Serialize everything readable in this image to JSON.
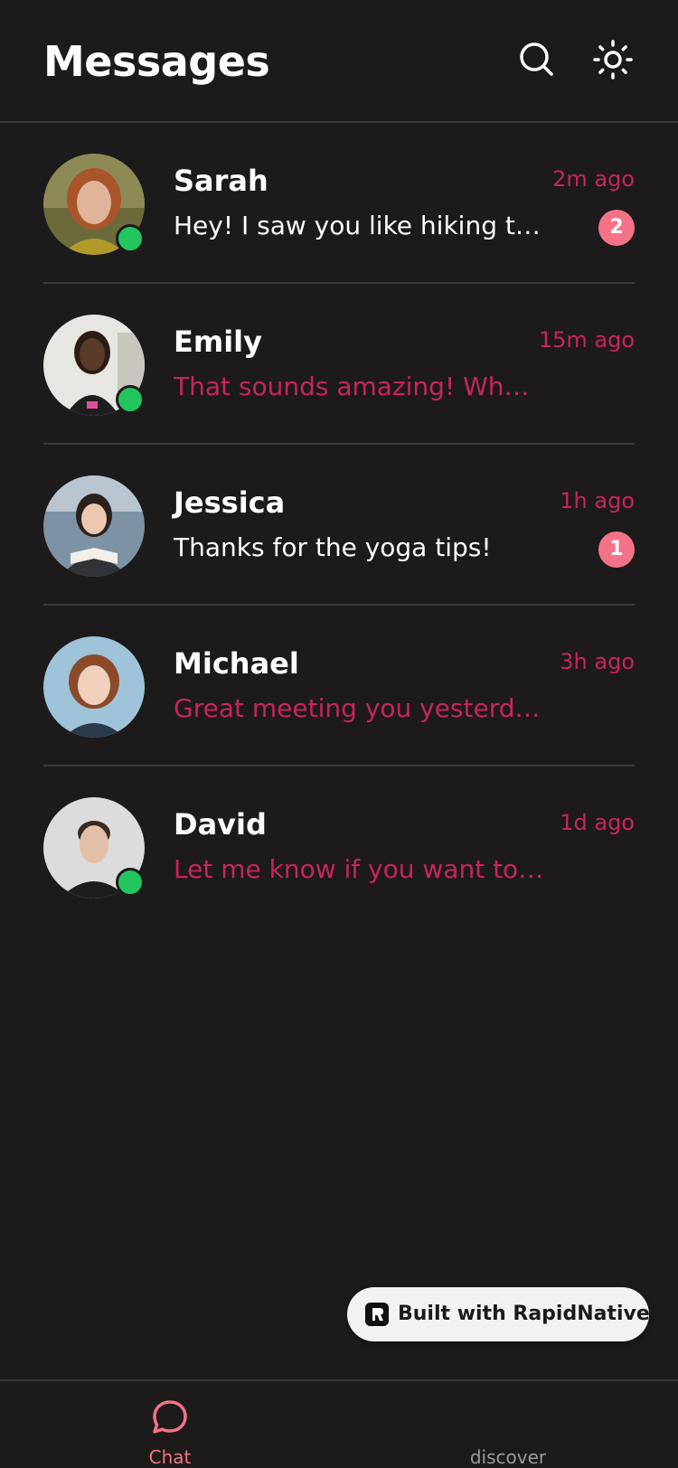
{
  "header": {
    "title": "Messages",
    "search_icon": "search-icon",
    "theme_icon": "sun-icon"
  },
  "chats": [
    {
      "name": "Sarah",
      "time": "2m ago",
      "preview": "Hey! I saw you like hiking too!",
      "unread": "2",
      "online": true,
      "preview_highlight": false
    },
    {
      "name": "Emily",
      "time": "15m ago",
      "preview": "That sounds amazing! When ...",
      "unread": null,
      "online": true,
      "preview_highlight": true
    },
    {
      "name": "Jessica",
      "time": "1h ago",
      "preview": "Thanks for the yoga tips!",
      "unread": "1",
      "online": false,
      "preview_highlight": false
    },
    {
      "name": "Michael",
      "time": "3h ago",
      "preview": "Great meeting you yesterday!",
      "unread": null,
      "online": false,
      "preview_highlight": true
    },
    {
      "name": "David",
      "time": "1d ago",
      "preview": "Let me know if you want to gr...",
      "unread": null,
      "online": true,
      "preview_highlight": true
    }
  ],
  "built_badge": {
    "label": "Built with RapidNative"
  },
  "bottom_nav": {
    "items": [
      {
        "label": "Chat",
        "icon": "chat-bubble-icon",
        "active": true
      },
      {
        "label": "discover",
        "icon": "compass-icon",
        "active": false
      }
    ]
  },
  "colors": {
    "background": "#1c1a1b",
    "accent_pink": "#c8245e",
    "badge_pink": "#f47287",
    "online_green": "#22c55e"
  }
}
